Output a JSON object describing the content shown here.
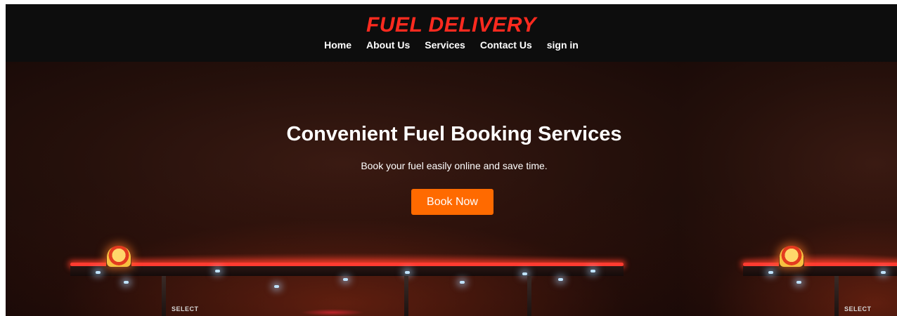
{
  "brand": {
    "title": "FUEL DELIVERY"
  },
  "nav": {
    "items": [
      {
        "label": "Home"
      },
      {
        "label": "About Us"
      },
      {
        "label": "Services"
      },
      {
        "label": "Contact Us"
      },
      {
        "label": "sign in"
      }
    ]
  },
  "hero": {
    "title": "Convenient Fuel Booking Services",
    "subtitle": "Book your fuel easily online and save time.",
    "cta_label": "Book Now",
    "sign_text": "SELECT"
  },
  "colors": {
    "brand": "#ff2a1f",
    "accent": "#ff6a00",
    "header_bg": "#0d0d0d"
  }
}
